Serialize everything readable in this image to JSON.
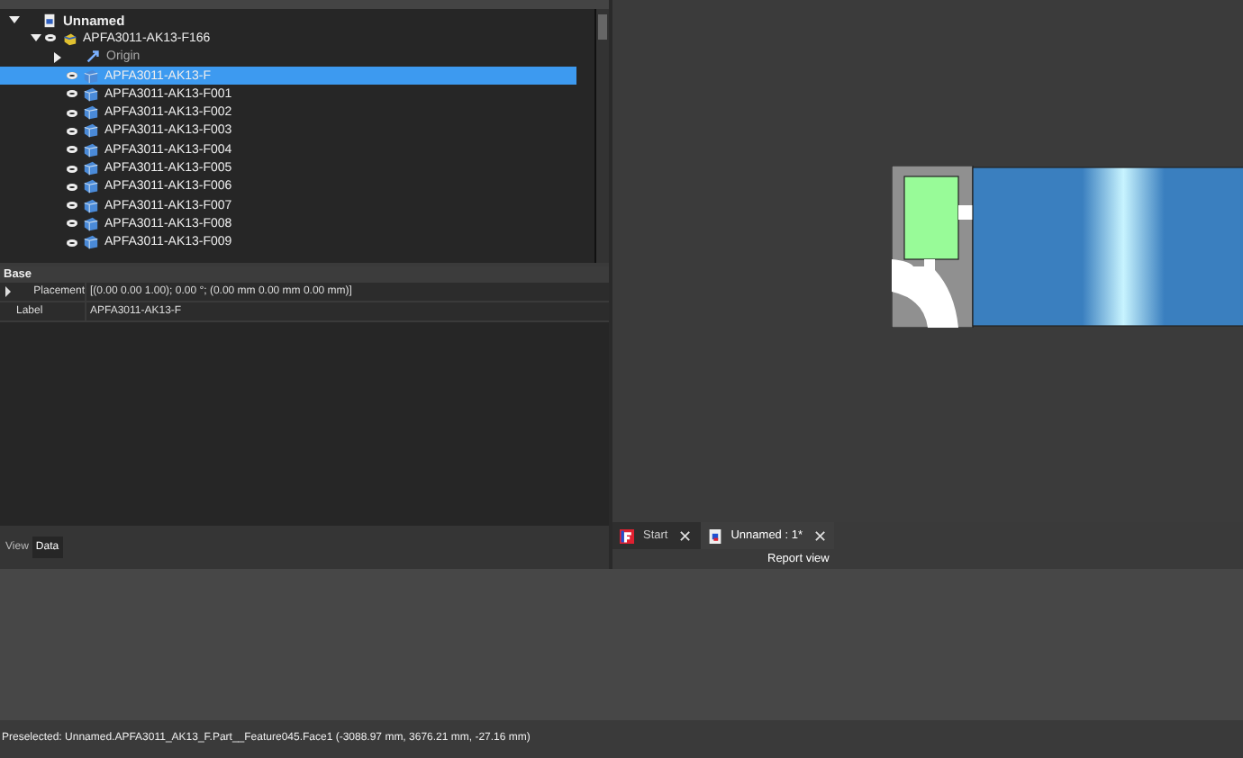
{
  "model_panel": {
    "tree": [
      {
        "label": "Unnamed",
        "kind": "document",
        "expanded": true,
        "selected": false,
        "children": [
          {
            "label": "APFA3011-AK13-F166",
            "kind": "part",
            "expanded": true,
            "selected": false,
            "visible": true,
            "children": [
              {
                "label": "Origin",
                "kind": "origin",
                "expanded": false,
                "selected": false,
                "visible": false
              },
              {
                "label": "APFA3011-AK13-F",
                "kind": "feature",
                "selected": true,
                "visible": true
              },
              {
                "label": "APFA3011-AK13-F001",
                "kind": "feature",
                "selected": false,
                "visible": true
              },
              {
                "label": "APFA3011-AK13-F002",
                "kind": "feature",
                "selected": false,
                "visible": true
              },
              {
                "label": "APFA3011-AK13-F003",
                "kind": "feature",
                "selected": false,
                "visible": true
              },
              {
                "label": "APFA3011-AK13-F004",
                "kind": "feature",
                "selected": false,
                "visible": true
              },
              {
                "label": "APFA3011-AK13-F005",
                "kind": "feature",
                "selected": false,
                "visible": true
              },
              {
                "label": "APFA3011-AK13-F006",
                "kind": "feature",
                "selected": false,
                "visible": true
              },
              {
                "label": "APFA3011-AK13-F007",
                "kind": "feature",
                "selected": false,
                "visible": true
              },
              {
                "label": "APFA3011-AK13-F008",
                "kind": "feature",
                "selected": false,
                "visible": true
              },
              {
                "label": "APFA3011-AK13-F009",
                "kind": "feature",
                "selected": false,
                "visible": true
              }
            ]
          }
        ]
      }
    ]
  },
  "properties": {
    "group": "Base",
    "rows": [
      {
        "name": "Placement",
        "value": "[(0.00 0.00 1.00); 0.00 °; (0.00 mm  0.00 mm  0.00 mm)]",
        "expandable": true
      },
      {
        "name": "Label",
        "value": "APFA3011-AK13-F",
        "expandable": false
      }
    ]
  },
  "panel_tabs": [
    {
      "label": "View",
      "selected": false
    },
    {
      "label": "Data",
      "selected": true
    }
  ],
  "view_tabs": [
    {
      "label": "Start",
      "kind": "start",
      "selected": false,
      "close": "✕"
    },
    {
      "label": "Unnamed : 1*",
      "kind": "document",
      "selected": true,
      "close": "✕"
    }
  ],
  "report_view": {
    "title": "Report view"
  },
  "status_bar": "Preselected: Unnamed.APFA3011_AK13_F.Part__Feature045.Face1 (-3088.97 mm, 3676.21 mm, -27.16 mm)"
}
